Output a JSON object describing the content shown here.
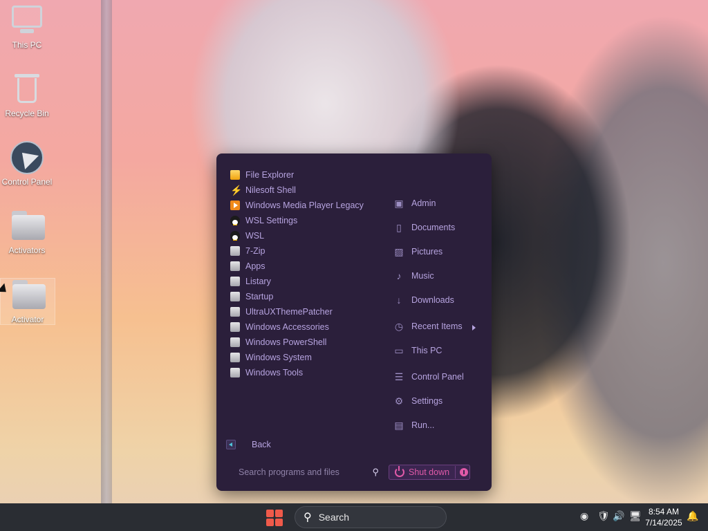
{
  "desktop": {
    "icons": [
      {
        "label": "This PC",
        "icon": "computer-icon"
      },
      {
        "label": "Recycle Bin",
        "icon": "recycle-bin-icon"
      },
      {
        "label": "Control Panel",
        "icon": "control-panel-icon"
      },
      {
        "label": "Activators",
        "icon": "folder-icon"
      },
      {
        "label": "Activator",
        "icon": "folder-icon"
      }
    ]
  },
  "start_menu": {
    "programs": [
      {
        "label": "File Explorer",
        "icon": "file-explorer-icon"
      },
      {
        "label": "Nilesoft Shell",
        "icon": "nilesoft-shell-icon"
      },
      {
        "label": "Windows Media Player Legacy",
        "icon": "media-player-icon"
      },
      {
        "label": "WSL Settings",
        "icon": "tux-icon"
      },
      {
        "label": "WSL",
        "icon": "tux-icon"
      },
      {
        "label": "7-Zip",
        "icon": "folder-icon"
      },
      {
        "label": "Apps",
        "icon": "folder-icon"
      },
      {
        "label": "Listary",
        "icon": "folder-icon"
      },
      {
        "label": "Startup",
        "icon": "folder-icon"
      },
      {
        "label": "UltraUXThemePatcher",
        "icon": "folder-icon"
      },
      {
        "label": "Windows Accessories",
        "icon": "folder-icon"
      },
      {
        "label": "Windows PowerShell",
        "icon": "folder-icon"
      },
      {
        "label": "Windows System",
        "icon": "folder-icon"
      },
      {
        "label": "Windows Tools",
        "icon": "folder-icon"
      }
    ],
    "places": [
      {
        "label": "Admin",
        "icon": "user-folder-icon"
      },
      {
        "label": "Documents",
        "icon": "document-icon"
      },
      {
        "label": "Pictures",
        "icon": "picture-icon"
      },
      {
        "label": "Music",
        "icon": "music-icon"
      },
      {
        "label": "Downloads",
        "icon": "download-icon"
      },
      {
        "label": "Recent Items",
        "icon": "clock-icon"
      },
      {
        "label": "This PC",
        "icon": "computer-icon"
      },
      {
        "label": "Control Panel",
        "icon": "control-panel-icon"
      },
      {
        "label": "Settings",
        "icon": "gear-icon"
      },
      {
        "label": "Run...",
        "icon": "run-icon"
      }
    ],
    "back_label": "Back",
    "search_placeholder": "Search programs and files",
    "shutdown_label": "Shut down"
  },
  "taskbar": {
    "search_label": "Search",
    "time": "8:54 AM",
    "date": "7/14/2025"
  },
  "colors": {
    "menu_bg": "#2b1f3b",
    "menu_text": "#b7a4e0",
    "shutdown_accent": "#e05aa8",
    "taskbar_bg": "#2a2d33",
    "start_logo": "#ef5a4a"
  }
}
